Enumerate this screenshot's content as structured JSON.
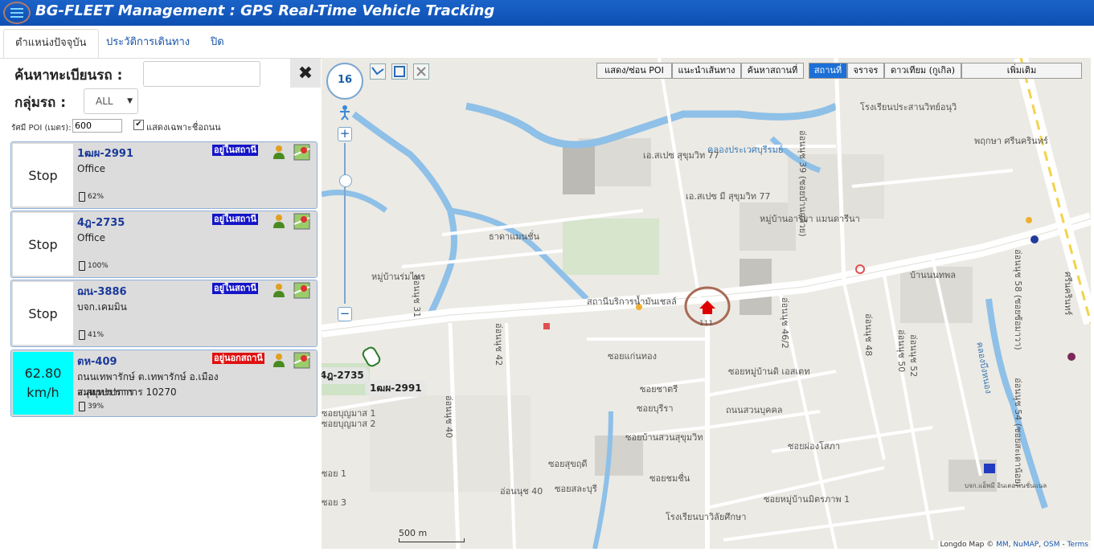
{
  "app": {
    "title": "BG-FLEET Management : GPS Real-Time Vehicle Tracking"
  },
  "tabs": [
    {
      "label": "ตำแหน่งปัจจุบัน"
    },
    {
      "label": "ประวัติการเดินทาง"
    },
    {
      "label": "ปิด"
    }
  ],
  "search": {
    "plate_label": "ค้นหาทะเบียนรถ :",
    "plate_value": "",
    "group_label": "กลุ่มรถ :",
    "group_value": "ALL"
  },
  "poi": {
    "radius_label": "รัศมี POI (เมตร):",
    "radius_value": "600",
    "road_only_label": "แสดงเฉพาะชื่อถนน",
    "road_only_checked": true
  },
  "vehicles": [
    {
      "status": "Stop",
      "plate": "1ฒผ-2991",
      "badge": "อยู่ในสถานี",
      "location": "Office",
      "fuel": "62%"
    },
    {
      "status": "Stop",
      "plate": "4ฎ-2735",
      "badge": "อยู่ในสถานี",
      "location": "Office",
      "fuel": "100%"
    },
    {
      "status": "Stop",
      "plate": "ฌน-3886",
      "badge": "อยู่ในสถานี",
      "location": "บจก.เคมมิน",
      "fuel": "41%"
    },
    {
      "status_speed": "62.80",
      "status_unit": "km/h",
      "plate": "ตห-409",
      "badge": "อยู่นอกสถานี",
      "location_line1": "ถนนเทพารักษ์ ต.เทพารักษ์ อ.เมืองสมุทรปราการ",
      "location_line2": "จ.สมุทรปราการ 10270",
      "fuel": "39%"
    }
  ],
  "map": {
    "zoom": "16",
    "buttons": {
      "poi": "แสดง/ซ่อน POI",
      "route": "แนะนำเส้นทาง",
      "find_place": "ค้นหาสถานที่"
    },
    "layers": {
      "place": "สถานที่",
      "traffic": "จราจร",
      "satellite": "ดาวเทียม (กูเกิล)",
      "more": "เพิ่มเติม"
    },
    "labels": {
      "school": "โรงเรียนประสานวิทย์อนุวิ",
      "canal": "คลองประเวศบุรีรมย์",
      "soi39": "อ่อนนุช 39 (ซอยบ้านกล้วย)",
      "esp77": "เอ.สเปซ สุขุมวิท 77",
      "esp77b": "เอ.สเปซ มี สุขุมวิท 77",
      "arri": "หมู่บ้านอารียา แมนดารีนา",
      "srinak": "พฤกษา ศรีนครินทร์",
      "thada": "ธาดาแมนชั่น",
      "rom": "หมู่บ้านร่มไทร",
      "onnut31": "อ่อนนุช 31",
      "gas": "สถานีบริการน้ำมันเชลล์",
      "nanthawan": "บ้านนนทพล",
      "onnut46": "อ่อนนุช 46/2",
      "onnut48": "อ่อนนุช 48",
      "onnut50": "อ่อนนุช 50",
      "onnut52": "อ่อนนุช 52",
      "onnut58": "อ่อนนุช 58 (ซอยซ้อมาวา)",
      "srinakrd": "ศรีนครินทร์",
      "onnut42": "อ่อนนุช 42",
      "soikan": "ซอยแก่นทอง",
      "soichat": "ซอยชาตรี",
      "soiburi": "ซอยบุรีรา",
      "soiaset": "ซอยหมู่บ้านดิ เอสเตท",
      "soisuan": "ถนนสวนบุคคล",
      "soisuan2": "ซอยบ้านสวนสุขุมวิท",
      "soiboon1": "ซอยบุญมาส 1",
      "soiboon2": "ซอยบุญมาส 2",
      "onnut40": "อ่อนนุช 40",
      "soisuk": "ซอยสุขฤดี",
      "soichom": "ซอยชมชื่น",
      "soisa": "ซอยสละบุรี",
      "soiphong": "ซอยผ่องโสภา",
      "soimit": "ซอยหมู่บ้านมิตรภาพ 1",
      "school2": "โรงเรียนบาวิลัยศึกษา",
      "khlong": "คลองบึงหนอง",
      "onnut54": "อ่อนนุช 54 (ซอยสะเดาน้อย)",
      "bank": "บจก.แอ็พมี อินเตอร์เนชั่นแนล",
      "onnut40b": "อ่อนนุช 40",
      "soi1": "ซอย 1",
      "soi3": "ซอย 3",
      "marker": "111"
    },
    "vehicle_tags": [
      "4ฎ-2735",
      "1ฒผ-2991"
    ],
    "scale": "500 m",
    "attribution": {
      "prefix": "Longdo Map",
      "sep1": "©",
      "mm": "MM",
      "numap": "NuMAP",
      "osm": "OSM",
      "terms": "Terms"
    }
  },
  "colors": {
    "titlebar": "#1560c8",
    "badge_in": "#1414c8",
    "badge_out": "#e01010",
    "moving": "#00ffff"
  }
}
